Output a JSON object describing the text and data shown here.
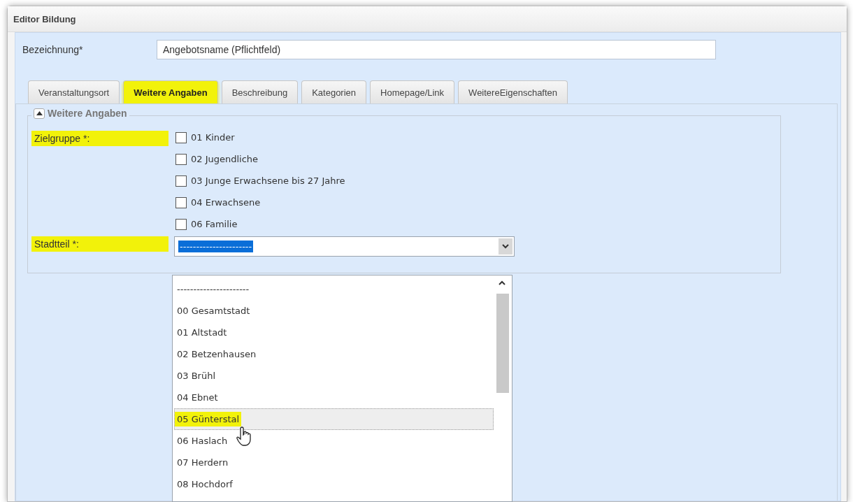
{
  "window": {
    "title": "Editor Bildung"
  },
  "name_field": {
    "label": "Bezeichnung*",
    "value": "Angebotsname (Pflichtfeld)"
  },
  "tabs": [
    {
      "label": "Veranstaltungsort",
      "selected": false,
      "highlighted": false
    },
    {
      "label": "Weitere Angaben",
      "selected": true,
      "highlighted": true
    },
    {
      "label": "Beschreibung",
      "selected": false,
      "highlighted": false
    },
    {
      "label": "Kategorien",
      "selected": false,
      "highlighted": false
    },
    {
      "label": "Homepage/Link",
      "selected": false,
      "highlighted": false
    },
    {
      "label": "WeitereEigenschaften",
      "selected": false,
      "highlighted": false
    }
  ],
  "section": {
    "title": "Weitere Angaben",
    "expanded": true
  },
  "target_group": {
    "label": "Zielgruppe *:",
    "highlighted": true,
    "options": [
      {
        "label": "01 Kinder",
        "checked": false
      },
      {
        "label": "02 Jugendliche",
        "checked": false
      },
      {
        "label": "03 Junge Erwachsene bis 27 Jahre",
        "checked": false
      },
      {
        "label": "04 Erwachsene",
        "checked": false
      },
      {
        "label": "06 Familie",
        "checked": false
      }
    ]
  },
  "district": {
    "label": "Stadtteil *:",
    "highlighted": true,
    "value": "----------------------",
    "expanded": true,
    "options": [
      {
        "label": "----------------------",
        "hovered": false,
        "highlighted": false
      },
      {
        "label": "00 Gesamtstadt",
        "hovered": false,
        "highlighted": false
      },
      {
        "label": "01 Altstadt",
        "hovered": false,
        "highlighted": false
      },
      {
        "label": "02 Betzenhausen",
        "hovered": false,
        "highlighted": false
      },
      {
        "label": "03 Brühl",
        "hovered": false,
        "highlighted": false
      },
      {
        "label": "04 Ebnet",
        "hovered": false,
        "highlighted": false
      },
      {
        "label": "05 Günterstal",
        "hovered": true,
        "highlighted": true
      },
      {
        "label": "06 Haslach",
        "hovered": false,
        "highlighted": false
      },
      {
        "label": "07 Herdern",
        "hovered": false,
        "highlighted": false
      },
      {
        "label": "08 Hochdorf",
        "hovered": false,
        "highlighted": false
      }
    ]
  }
}
